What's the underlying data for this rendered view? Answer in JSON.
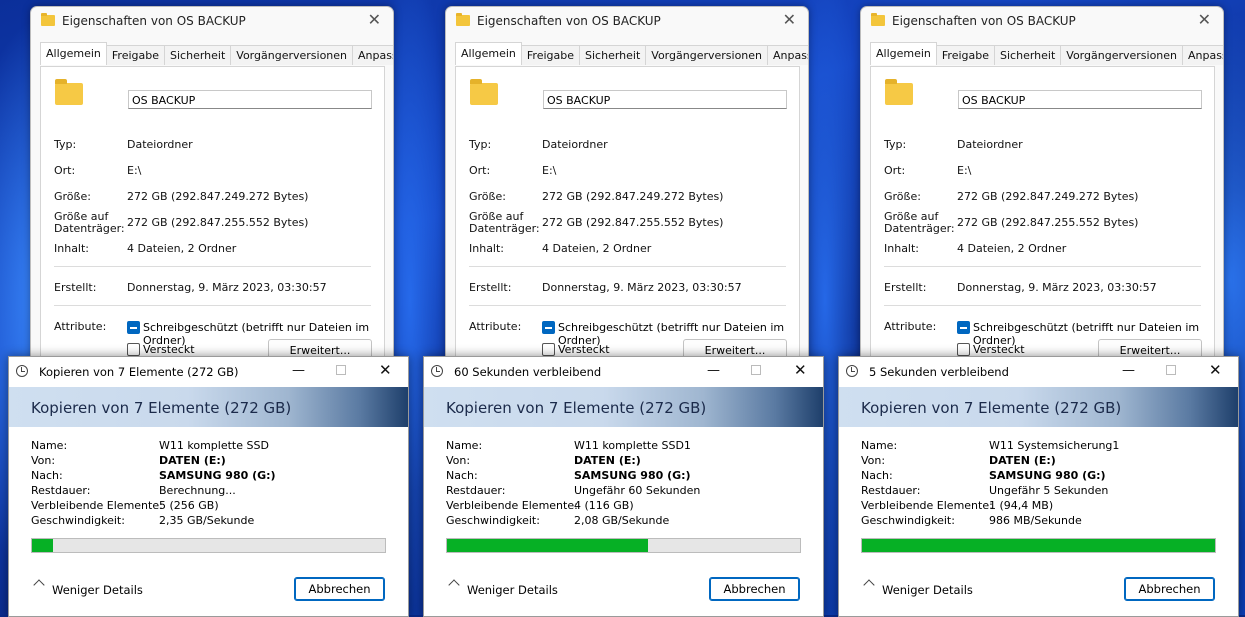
{
  "properties": {
    "title": "Eigenschaften von OS BACKUP",
    "close_icon": "close-icon",
    "tabs": [
      "Allgemein",
      "Freigabe",
      "Sicherheit",
      "Vorgängerversionen",
      "Anpassen"
    ],
    "folder_name": "OS BACKUP",
    "rows": {
      "type_label": "Typ:",
      "type_value": "Dateiordner",
      "location_label": "Ort:",
      "location_value": "E:\\",
      "size_label": "Größe:",
      "size_value": "272 GB (292.847.249.272 Bytes)",
      "disk_label_1": "Größe auf",
      "disk_label_2": "Datenträger:",
      "disk_value": "272 GB (292.847.255.552 Bytes)",
      "contents_label": "Inhalt:",
      "contents_value": "4 Dateien, 2 Ordner",
      "created_label": "Erstellt:",
      "created_value": "Donnerstag, 9. März 2023, 03:30:57",
      "attributes_label": "Attribute:",
      "readonly_label": "Schreibgeschützt (betrifft nur Dateien im Ordner)",
      "hidden_label": "Versteckt",
      "advanced_button": "Erweitert..."
    }
  },
  "panels": [
    {
      "dialog_title": "Kopieren von 7 Elemente (272 GB)",
      "heading": "Kopieren von 7 Elemente (272 GB)",
      "labels": {
        "name": "Name:",
        "from": "Von:",
        "to": "Nach:",
        "remaining": "Restdauer:",
        "items": "Verbleibende Elemente:",
        "speed": "Geschwindigkeit:"
      },
      "values": {
        "name": "W11 komplette SSD",
        "from": "DATEN (E:)",
        "to": "SAMSUNG 980 (G:)",
        "remaining": "Berechnung...",
        "items": "5 (256 GB)",
        "speed": "2,35 GB/Sekunde"
      },
      "progress_percent": 6,
      "less_details": "Weniger Details",
      "cancel": "Abbrechen"
    },
    {
      "dialog_title": "60 Sekunden verbleibend",
      "heading": "Kopieren von 7 Elemente (272 GB)",
      "labels": {
        "name": "Name:",
        "from": "Von:",
        "to": "Nach:",
        "remaining": "Restdauer:",
        "items": "Verbleibende Elemente:",
        "speed": "Geschwindigkeit:"
      },
      "values": {
        "name": "W11 komplette SSD1",
        "from": "DATEN (E:)",
        "to": "SAMSUNG 980 (G:)",
        "remaining": "Ungefähr 60 Sekunden",
        "items": "4 (116 GB)",
        "speed": "2,08 GB/Sekunde"
      },
      "progress_percent": 57,
      "less_details": "Weniger Details",
      "cancel": "Abbrechen"
    },
    {
      "dialog_title": "5 Sekunden verbleibend",
      "heading": "Kopieren von 7 Elemente (272 GB)",
      "labels": {
        "name": "Name:",
        "from": "Von:",
        "to": "Nach:",
        "remaining": "Restdauer:",
        "items": "Verbleibende Elemente:",
        "speed": "Geschwindigkeit:"
      },
      "values": {
        "name": "W11 Systemsicherung1",
        "from": "DATEN (E:)",
        "to": "SAMSUNG 980 (G:)",
        "remaining": "Ungefähr 5 Sekunden",
        "items": "1 (94,4 MB)",
        "speed": "986 MB/Sekunde"
      },
      "progress_percent": 100,
      "less_details": "Weniger Details",
      "cancel": "Abbrechen"
    }
  ],
  "colors": {
    "progress": "#06b025",
    "accent": "#0067c0"
  }
}
